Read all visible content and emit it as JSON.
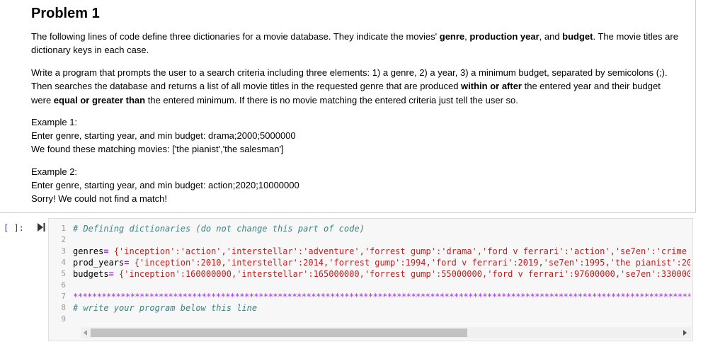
{
  "markdown": {
    "title": "Problem 1",
    "p1": {
      "a": "The following lines of code define three dictionaries for a movie database. They indicate the movies' ",
      "b1": "genre",
      "c": ", ",
      "b2": "production year",
      "d": ", and ",
      "b3": "budget",
      "e": ". The movie titles are dictionary keys in each case."
    },
    "p2": {
      "a": "Write a program that prompts the user to a search criteria including three elements: 1) a genre, 2) a year, 3) a minimum budget, separated by semicolons (;). Then searches the database and returns a list of all movie titles in the requested genre that are produced ",
      "b1": "within or after",
      "c": " the entered year and their budget were ",
      "b2": "equal or greater than",
      "d": " the entered minimum. If there is no movie matching the entered criteria just tell the user so."
    },
    "ex1": {
      "label": "Example 1:",
      "line1": "Enter genre, starting year, and min budget: drama;2000;5000000",
      "line2": "We found these matching movies: ['the pianist','the salesman']"
    },
    "ex2": {
      "label": "Example 2:",
      "line1": "Enter genre, starting year, and min budget: action;2020;10000000",
      "line2": "Sorry! We could not find a match!"
    }
  },
  "code_cell": {
    "prompt": "[ ]:",
    "line_numbers": [
      "1",
      "2",
      "3",
      "4",
      "5",
      "6",
      "7",
      "8",
      "9"
    ],
    "comment1": "# Defining dictionaries (do not change this part of code)",
    "genres": {
      "name": "genres",
      "op": "=",
      "rest": " {'inception':'action','interstellar':'adventure','forrest gump':'drama','ford v ferrari':'action','se7en':'crime"
    },
    "prod_years": {
      "name": "prod_years",
      "op": "=",
      "rest": " {'inception':2010,'interstellar':2014,'forrest gump':1994,'ford v ferrari':2019,'se7en':1995,'the pianist':20"
    },
    "budgets": {
      "name": "budgets",
      "op": "=",
      "rest": " {'inception':160000000,'interstellar':165000000,'forrest gump':55000000,'ford v ferrari':97600000,'se7en':330000"
    },
    "stars": "*****************************************************************************************************************************************",
    "comment2": "# write your program below this line"
  }
}
